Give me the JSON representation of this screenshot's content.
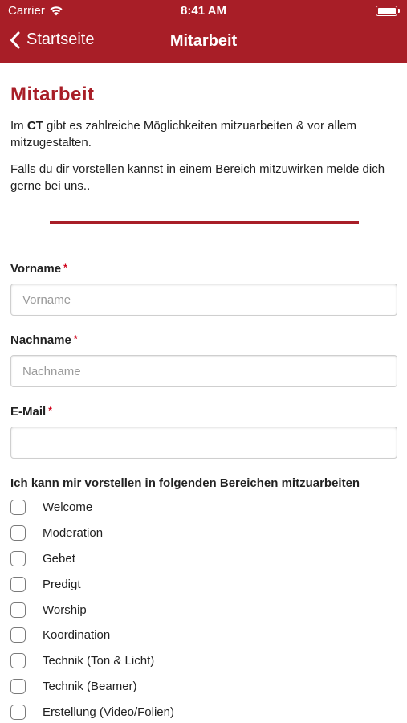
{
  "status_bar": {
    "carrier": "Carrier",
    "time": "8:41 AM"
  },
  "nav": {
    "back_label": "Startseite",
    "title": "Mitarbeit"
  },
  "page": {
    "title": "Mitarbeit",
    "intro_prefix": "Im ",
    "intro_bold": "CT",
    "intro_rest": " gibt es zahlreiche Möglichkeiten mitzuarbeiten & vor allem mitzugestalten.",
    "intro2": "Falls du dir vorstellen kannst in einem Bereich mitzuwirken melde dich gerne bei uns.."
  },
  "form": {
    "required_marker": "*",
    "vorname": {
      "label": "Vorname",
      "placeholder": "Vorname",
      "value": ""
    },
    "nachname": {
      "label": "Nachname",
      "placeholder": "Nachname",
      "value": ""
    },
    "email": {
      "label": "E-Mail",
      "placeholder": "",
      "value": ""
    },
    "areas_label": "Ich kann mir vorstellen in folgenden Bereichen mitzuarbeiten",
    "areas": [
      "Welcome",
      "Moderation",
      "Gebet",
      "Predigt",
      "Worship",
      "Koordination",
      "Technik (Ton & Licht)",
      "Technik (Beamer)",
      "Erstellung (Video/Folien)"
    ]
  },
  "colors": {
    "accent": "#a81e27",
    "required": "#d0021b"
  }
}
